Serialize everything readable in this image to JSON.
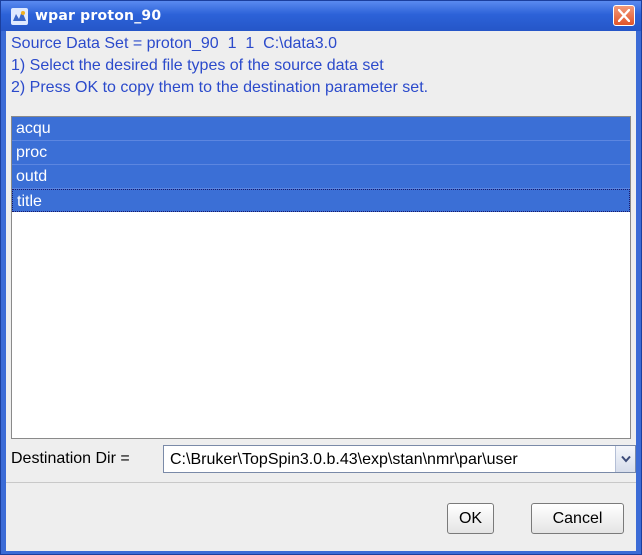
{
  "window": {
    "title": "wpar proton_90",
    "icon": "topspin-app-icon"
  },
  "info": {
    "line1": "Source Data Set = proton_90  1  1  C:\\data3.0",
    "line2": "1) Select the desired file types of the source data set",
    "line3": "2) Press OK to copy them to the destination parameter set."
  },
  "file_list": {
    "items": [
      {
        "label": "acqu",
        "selected": true
      },
      {
        "label": "proc",
        "selected": true
      },
      {
        "label": "outd",
        "selected": true
      },
      {
        "label": "title",
        "selected": true
      }
    ]
  },
  "destination": {
    "label": "Destination Dir =",
    "value": "C:\\Bruker\\TopSpin3.0.b.43\\exp\\stan\\nmr\\par\\user"
  },
  "buttons": {
    "ok": "OK",
    "cancel": "Cancel"
  },
  "colors": {
    "selection": "#3b6fd6",
    "info_text": "#2b4acb",
    "titlebar": "#2c62d8"
  }
}
